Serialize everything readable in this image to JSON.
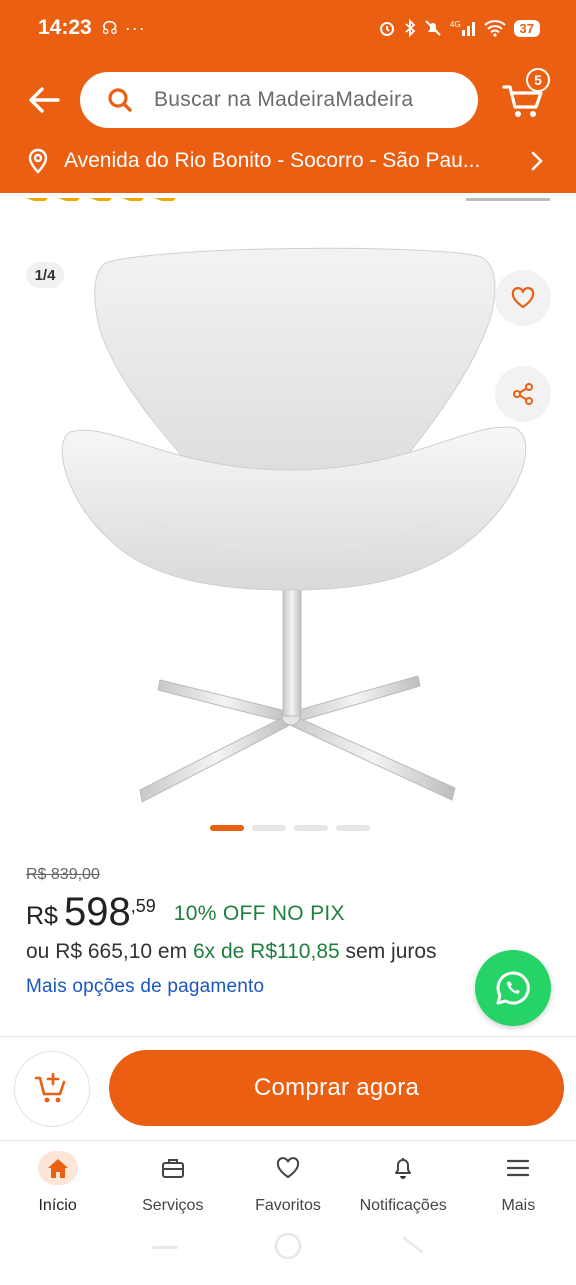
{
  "status_bar": {
    "time": "14:23",
    "extras": "☊ ···",
    "icons": "⏰ ✶ 🔕 4Gᵢ∥ ◠",
    "battery": "37"
  },
  "header": {
    "search_placeholder": "Buscar na MadeiraMadeira",
    "cart_count": "5",
    "address": "Avenida do Rio Bonito - Socorro - São Pau..."
  },
  "gallery": {
    "counter": "1/4",
    "slides": 4,
    "active_slide": 1
  },
  "price": {
    "old": "R$ 839,00",
    "currency": "R$",
    "integer": "598",
    "cents": ",59",
    "discount": "10% OFF NO PIX",
    "installments_prefix": "ou R$ 665,10 em",
    "installments_highlight": "6x de R$110,85",
    "installments_suffix": "sem juros",
    "more_payment_link": "Mais opções de pagamento"
  },
  "actions": {
    "buy_label": "Comprar agora"
  },
  "tabbar": {
    "items": [
      {
        "label": "Início",
        "icon": "home-icon",
        "active": true
      },
      {
        "label": "Serviços",
        "icon": "briefcase-icon",
        "active": false
      },
      {
        "label": "Favoritos",
        "icon": "heart-icon",
        "active": false
      },
      {
        "label": "Notificações",
        "icon": "bell-icon",
        "active": false
      },
      {
        "label": "Mais",
        "icon": "menu-icon",
        "active": false
      }
    ]
  },
  "colors": {
    "brand": "#ea5f12",
    "discount_green": "#1e7f3f",
    "link_blue": "#1b57c2",
    "whatsapp": "#25d366"
  }
}
